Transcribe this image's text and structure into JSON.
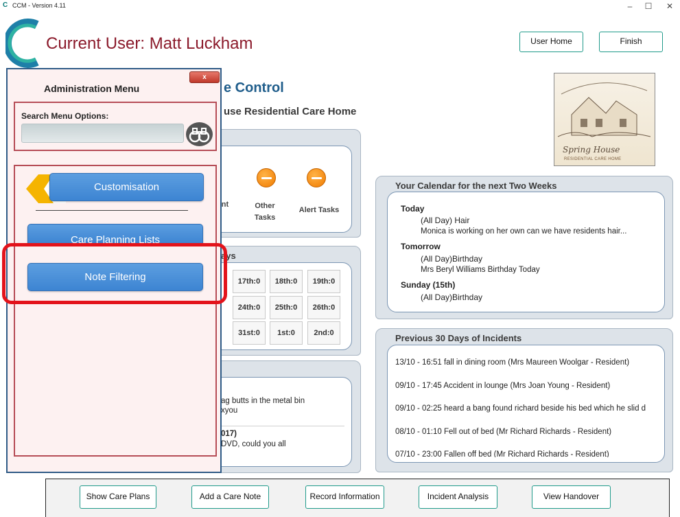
{
  "window": {
    "title": "CCM - Version 4.11",
    "app_icon": "ccm-logo-icon"
  },
  "header": {
    "current_user": "Current User: Matt Luckham",
    "user_home_label": "User Home",
    "finish_label": "Finish"
  },
  "background": {
    "title": "e Control",
    "subtitle": "use Residential Care Home",
    "photo_name": "Spring House",
    "photo_sub": "RESIDENTIAL CARE HOME"
  },
  "tasks": {
    "labels": [
      "nt",
      "Other Tasks",
      "Alert Tasks"
    ]
  },
  "days_panel": {
    "title": "ays",
    "cells": [
      "17th:0",
      "18th:0",
      "19th:0",
      "24th:0",
      "25th:0",
      "26th:0",
      "31st:0",
      "1st:0",
      "2nd:0"
    ]
  },
  "notes_panel": {
    "line1": "ag butts in the metal bin",
    "line2": "xyou",
    "line3": "017)",
    "line4": "DVD, could you all"
  },
  "calendar": {
    "title": "Your Calendar for the next Two Weeks",
    "lines": [
      {
        "text": "Today",
        "bold": true
      },
      {
        "text": "(All Day) Hair",
        "bold": false
      },
      {
        "text": "Monica is working on her own can we have residents hair...",
        "bold": false
      },
      {
        "text": "Tomorrow",
        "bold": true
      },
      {
        "text": "(All Day)Birthday",
        "bold": false
      },
      {
        "text": "Mrs Beryl Williams Birthday Today",
        "bold": false
      },
      {
        "text": "Sunday (15th)",
        "bold": true
      },
      {
        "text": "(All Day)Birthday",
        "bold": false
      }
    ]
  },
  "incidents": {
    "title": "Previous 30 Days of Incidents",
    "items": [
      "13/10 - 16:51 fall in dining room (Mrs Maureen Woolgar - Resident)",
      "09/10 - 17:45 Accident in lounge (Mrs Joan Young - Resident)",
      "09/10 - 02:25 heard a bang found richard beside his bed which he slid d",
      "08/10 - 01:10 Fell out of bed (Mr Richard Richards - Resident)",
      "07/10 - 23:00 Fallen off bed (Mr Richard Richards - Resident)"
    ]
  },
  "admin_menu": {
    "close_label": "x",
    "title": "Administration Menu",
    "search_label": "Search Menu Options:",
    "search_value": "",
    "customisation_label": "Customisation",
    "care_planning_label": "Care Planning Lists",
    "note_filtering_label": "Note Filtering"
  },
  "bottom_bar": {
    "buttons": [
      "Show Care Plans",
      "Add a Care Note",
      "Record Information",
      "Incident Analysis",
      "View Handover"
    ]
  }
}
